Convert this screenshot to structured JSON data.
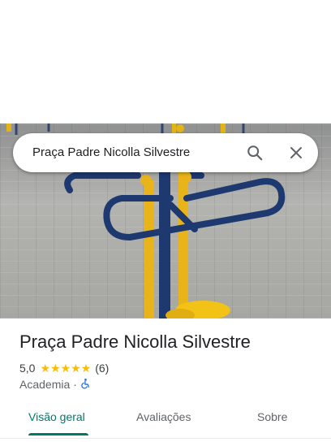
{
  "search": {
    "query": "Praça Padre Nicolla Silvestre",
    "search_icon": "search-icon",
    "close_icon": "close-icon"
  },
  "photo": {
    "subject": "outdoor-gym-equipment"
  },
  "place": {
    "title": "Praça Padre Nicolla Silvestre",
    "rating_value": "5,0",
    "rating_fraction": 1.0,
    "stars": "★★★★★",
    "review_count": "(6)",
    "category": "Academia",
    "separator": "·",
    "accessibility_icon": "wheelchair-icon"
  },
  "tabs": [
    {
      "label": "Visão geral",
      "active": true
    },
    {
      "label": "Avaliações",
      "active": false
    },
    {
      "label": "Sobre",
      "active": false
    }
  ],
  "colors": {
    "accent": "#00796b",
    "star": "#fbbc04",
    "accessibility": "#1a73e8",
    "text_primary": "#202124",
    "text_secondary": "#5f6368"
  }
}
